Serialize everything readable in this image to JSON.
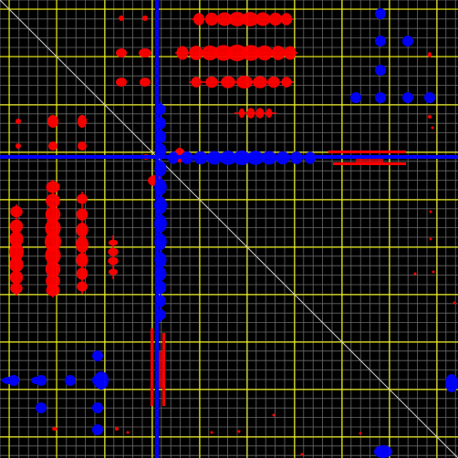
{
  "plot": {
    "kind": "2D NMR-style contour map (symmetric)",
    "colors": {
      "background": "#000000",
      "grid_major": "#ffff00",
      "grid_minor": "#6a6a6a",
      "diagonal": "#cfcfcf",
      "positive_contours": "#ff0000",
      "negative_contours": "#0000ff"
    }
  }
}
